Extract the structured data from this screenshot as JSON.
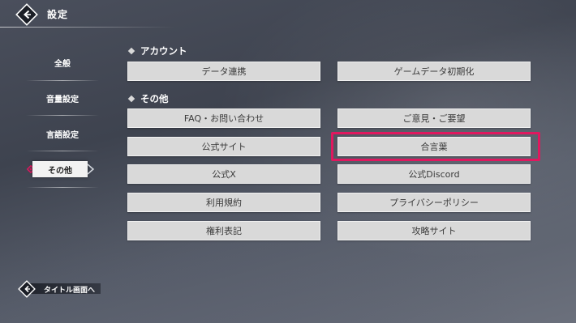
{
  "header": {
    "title": "設定",
    "back_icon": "back-arrow-icon"
  },
  "sidebar": {
    "items": [
      {
        "label": "全般",
        "active": false
      },
      {
        "label": "音量設定",
        "active": false
      },
      {
        "label": "言語設定",
        "active": false
      },
      {
        "label": "その他",
        "active": true
      }
    ]
  },
  "sections": {
    "account": {
      "title": "アカウント",
      "buttons": [
        "データ連携",
        "ゲームデータ初期化"
      ]
    },
    "other": {
      "title": "その他",
      "buttons": [
        "FAQ・お問い合わせ",
        "ご意見・ご要望",
        "公式サイト",
        "合言葉",
        "公式X",
        "公式Discord",
        "利用規約",
        "プライバシーポリシー",
        "権利表記",
        "攻略サイト"
      ]
    }
  },
  "footer": {
    "label": "タイトル画面へ"
  },
  "colors": {
    "highlight": "#e0185f",
    "button_bg": "#d9d9d9",
    "button_text": "#3a3a3a"
  }
}
